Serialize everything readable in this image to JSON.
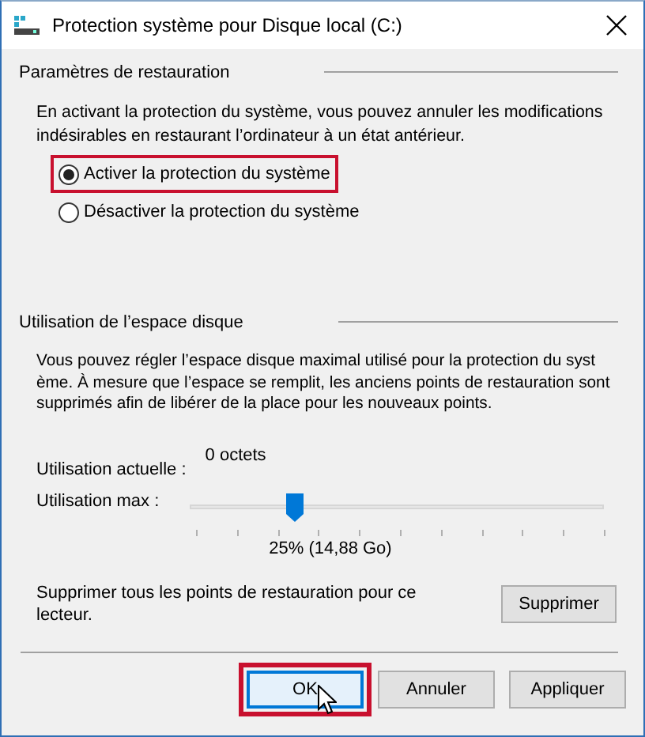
{
  "window": {
    "title": "Protection système pour Disque local (C:)"
  },
  "restore_settings": {
    "heading": "Paramètres de restauration",
    "description": "En activant la protection du système, vous pouvez annuler les modifications indésirables en restaurant l’ordinateur à un état antérieur.",
    "options": [
      {
        "label": "Activer la protection du système",
        "selected": true,
        "highlighted": true
      },
      {
        "label": "Désactiver la protection du système",
        "selected": false,
        "highlighted": false
      }
    ]
  },
  "disk_usage": {
    "heading": "Utilisation de l’espace disque",
    "description": "Vous pouvez régler l’espace disque maximal utilisé pour la protection du syst\nème. À mesure que l’espace se remplit, les anciens points de restauration sont supprimés afin de libérer de la place pour les nouveaux points.",
    "current_label": "Utilisation actuelle :",
    "current_value": "0 octets",
    "max_label": "Utilisation max :",
    "slider": {
      "level": 0.25
    },
    "max_reading": "25% (14,88 Go)",
    "delete_text": "Supprimer tous les points de restauration pour ce lecteur.",
    "delete_button": "Supprimer"
  },
  "buttons": [
    {
      "label": "OK",
      "default": true,
      "highlighted": true,
      "hovered": true
    },
    {
      "label": "Annuler",
      "default": false,
      "highlighted": false,
      "hovered": false
    },
    {
      "label": "Appliquer",
      "default": false,
      "highlighted": false,
      "hovered": false
    }
  ]
}
